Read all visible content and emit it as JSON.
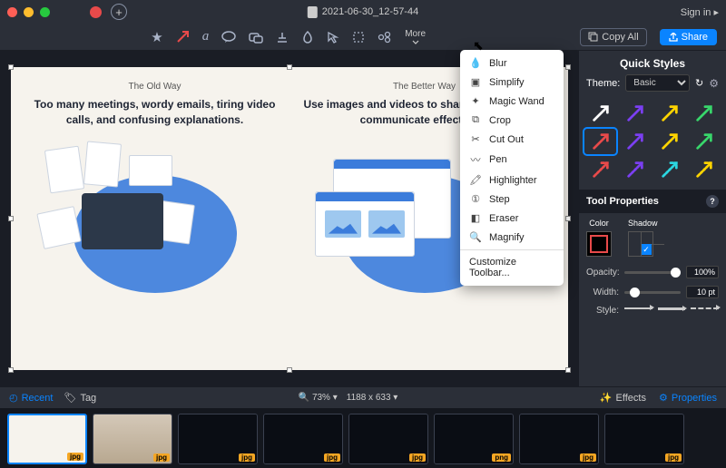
{
  "titlebar": {
    "filename": "2021-06-30_12-57-44",
    "signin": "Sign in ▸"
  },
  "toolbar": {
    "more_label": "More",
    "copy_all": "Copy All",
    "share": "Share"
  },
  "dropdown": {
    "items": [
      "Blur",
      "Simplify",
      "Magic Wand",
      "Crop",
      "Cut Out",
      "Pen",
      "Highlighter",
      "Step",
      "Eraser",
      "Magnify"
    ],
    "customize": "Customize Toolbar..."
  },
  "canvas": {
    "left_heading": "The Old Way",
    "left_body": "Too many meetings, wordy emails, tiring video calls, and confusing explanations.",
    "right_heading": "The Better Way",
    "right_body": "Use images and videos to share feedback, and communicate effectively."
  },
  "side": {
    "quick_styles": "Quick Styles",
    "theme_label": "Theme:",
    "theme_value": "Basic",
    "tool_props": "Tool Properties",
    "color_label": "Color",
    "shadow_label": "Shadow",
    "opacity_label": "Opacity:",
    "opacity_value": "100%",
    "width_label": "Width:",
    "width_value": "10 pt",
    "style_label": "Style:",
    "arrow_colors": [
      "#ffffff",
      "#7b3ff2",
      "#ffd400",
      "#38d66b",
      "#e84a4a",
      "#7b3ff2",
      "#ffd400",
      "#38d66b",
      "#e84a4a",
      "#7b3ff2",
      "#2bd6e0",
      "#ffd400"
    ]
  },
  "statusbar": {
    "recent": "Recent",
    "tag": "Tag",
    "zoom": "73%",
    "dimensions": "1188 x 633",
    "effects": "Effects",
    "properties": "Properties"
  },
  "tray": {
    "format": "jpg",
    "format_png": "png"
  }
}
